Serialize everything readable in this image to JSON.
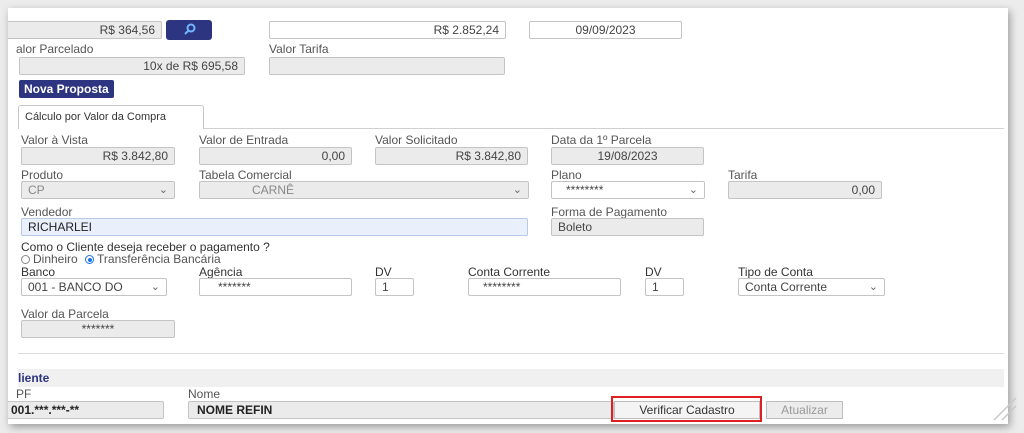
{
  "top": {
    "field1_value": "R$ 364,56",
    "field2_value": "R$ 2.852,24",
    "field3_value": "09/09/2023",
    "valor_parcelado_label": "alor Parcelado",
    "valor_parcelado_value": "10x de R$ 695,58",
    "valor_tarifa_label": "Valor Tarifa",
    "valor_tarifa_value": "",
    "nova_proposta_label": "Nova Proposta"
  },
  "tabs": [
    {
      "label": "Cálculo por Valor da Compra"
    }
  ],
  "form": {
    "valor_vista_label": "Valor à Vista",
    "valor_vista_value": "R$ 3.842,80",
    "valor_entrada_label": "Valor de Entrada",
    "valor_entrada_value": "0,00",
    "valor_solicitado_label": "Valor Solicitado",
    "valor_solicitado_value": "R$ 3.842,80",
    "data_parcela_label": "Data da 1º Parcela",
    "data_parcela_value": "19/08/2023",
    "produto_label": "Produto",
    "produto_value": "CP",
    "tabela_label": "Tabela Comercial",
    "tabela_value": "CARNÊ",
    "plano_label": "Plano",
    "plano_value": "********",
    "tarifa_label": "Tarifa",
    "tarifa_value": "0,00",
    "vendedor_label": "Vendedor",
    "vendedor_value": "RICHARLEI",
    "forma_label": "Forma de Pagamento",
    "forma_value": "Boleto",
    "recebimento_question": "Como o Cliente deseja receber o pagamento ?",
    "option_dinheiro": "Dinheiro",
    "option_transferencia": "Transferência Bancária",
    "banco_label": "Banco",
    "banco_value": "001 - BANCO DO",
    "agencia_label": "Agência",
    "agencia_value": "*******",
    "dv_label": "DV",
    "dv1_value": "1",
    "conta_label": "Conta Corrente",
    "conta_value": "********",
    "dv2_value": "1",
    "tipo_conta_label": "Tipo de Conta",
    "tipo_conta_value": "Conta Corrente",
    "valor_parcela_label": "Valor da Parcela",
    "valor_parcela_value": "*******"
  },
  "cliente": {
    "section_title": "liente",
    "cpf_label": "PF",
    "cpf_value": "001.***.***-**",
    "nome_label": "Nome",
    "nome_value": "NOME REFIN",
    "verificar_label": "Verificar Cadastro",
    "atualizar_label": "Atualizar"
  },
  "icons": {
    "search_button_icon": "magnifier-icon",
    "select_icon": "chevron-down-icon",
    "highlight_color": "#e02020",
    "accent_color": "#2d3580"
  }
}
